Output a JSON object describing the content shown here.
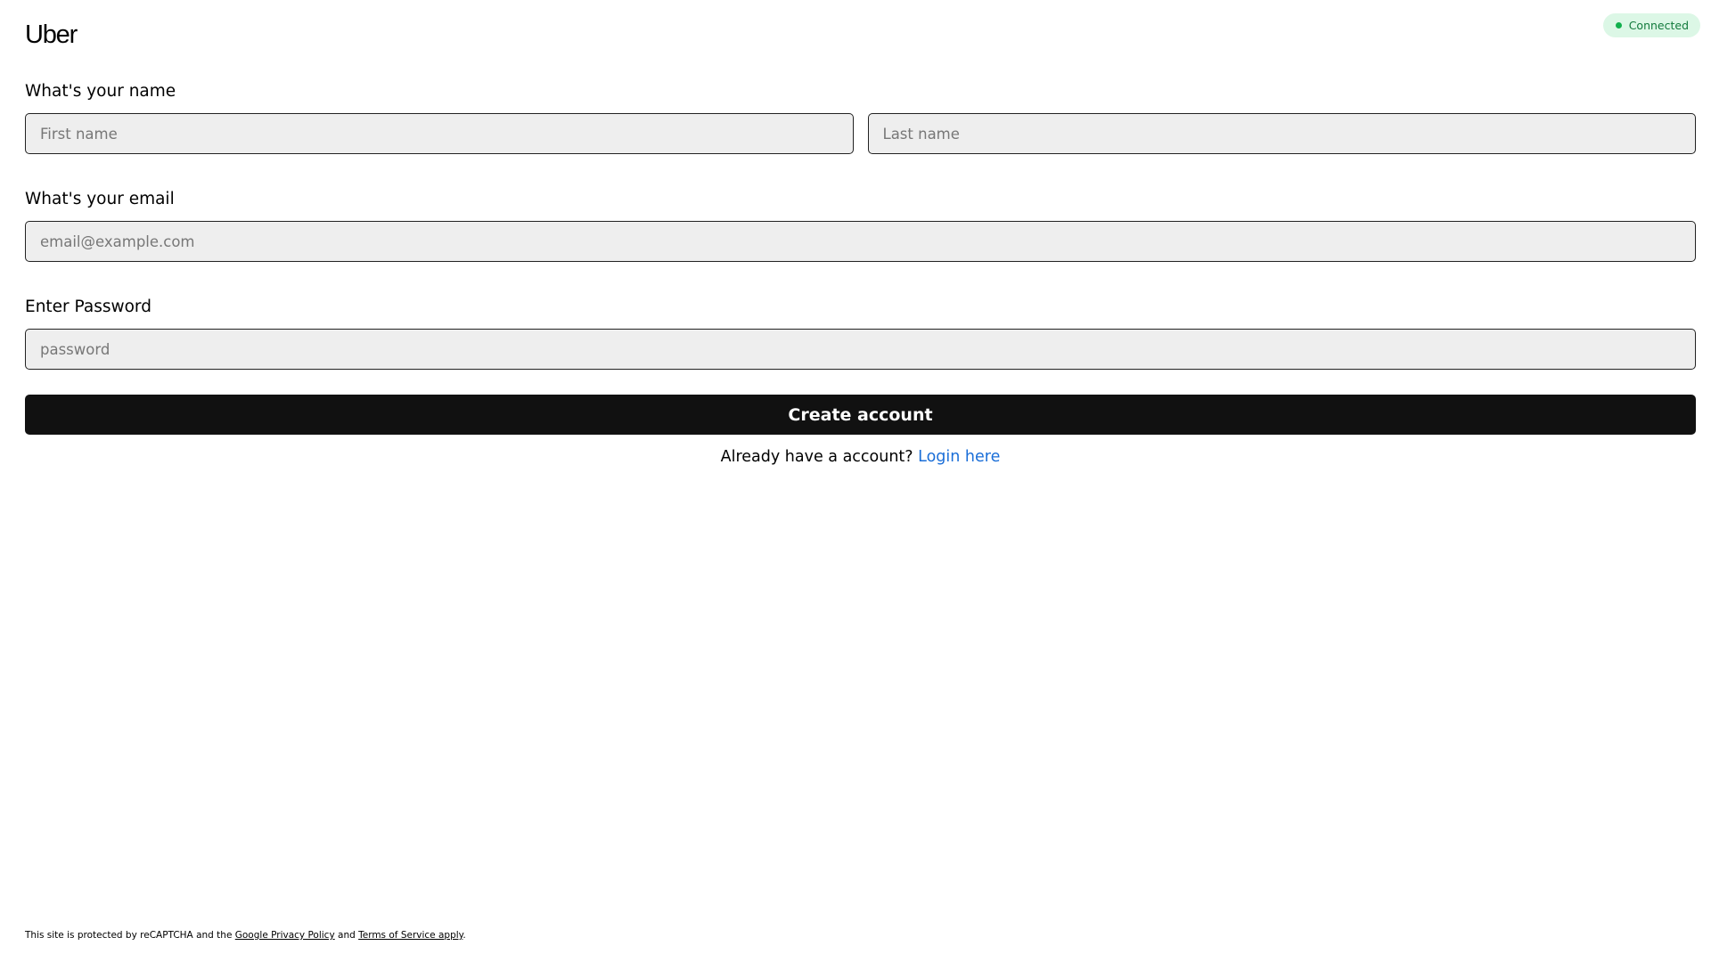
{
  "brand": {
    "logo_text": "Uber"
  },
  "connection": {
    "label": "Connected",
    "badge_bg": "#dcf7e6",
    "text_color": "#127a3c",
    "dot_color": "#12b04d"
  },
  "form": {
    "name_label": "What's your name",
    "first_name": {
      "value": "",
      "placeholder": "First name"
    },
    "last_name": {
      "value": "",
      "placeholder": "Last name"
    },
    "email_label": "What's your email",
    "email": {
      "value": "",
      "placeholder": "email@example.com"
    },
    "password_label": "Enter Password",
    "password": {
      "value": "",
      "placeholder": "password"
    },
    "submit_label": "Create account",
    "submit_bg": "#111111",
    "submit_text_color": "#ffffff"
  },
  "login_prompt": {
    "text": "Already have a account?",
    "link_label": "Login here",
    "link_color": "#1a6ed8"
  },
  "legal": {
    "prefix": "This site is protected by reCAPTCHA and the",
    "privacy_link": "Google Privacy Policy",
    "and": "and",
    "terms_link": "Terms of Service apply",
    "suffix": "."
  }
}
